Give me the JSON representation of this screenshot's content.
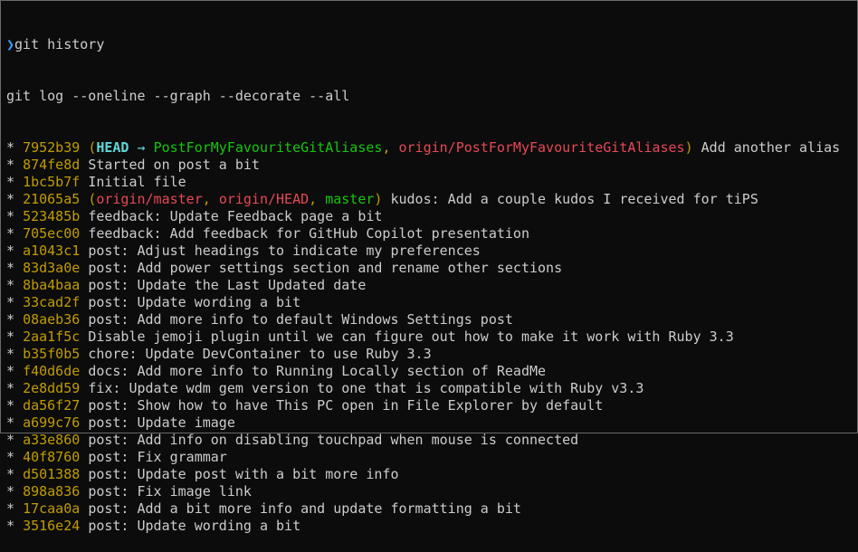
{
  "prompt": {
    "caret": "❯",
    "command": "git history"
  },
  "expanded_command": "git log --oneline --graph --decorate --all",
  "commits": [
    {
      "graph": "* ",
      "hash": "7952b39",
      "refs": {
        "head": "HEAD",
        "arrow": " → ",
        "current": "PostForMyFavouriteGitAliases",
        "others": [
          {
            "name": "origin/PostForMyFavouriteGitAliases",
            "type": "remote"
          }
        ]
      },
      "message": "Add another alias"
    },
    {
      "graph": "* ",
      "hash": "874fe8d",
      "message": "Started on post a bit"
    },
    {
      "graph": "* ",
      "hash": "1bc5b7f",
      "message": "Initial file"
    },
    {
      "graph": "* ",
      "hash": "21065a5",
      "refs": {
        "others": [
          {
            "name": "origin/master",
            "type": "remote"
          },
          {
            "name": "origin/HEAD",
            "type": "remote"
          },
          {
            "name": "master",
            "type": "local"
          }
        ]
      },
      "message": "kudos: Add a couple kudos I received for tiPS"
    },
    {
      "graph": "* ",
      "hash": "523485b",
      "message": "feedback: Update Feedback page a bit"
    },
    {
      "graph": "* ",
      "hash": "705ec00",
      "message": "feedback: Add feedback for GitHub Copilot presentation"
    },
    {
      "graph": "* ",
      "hash": "a1043c1",
      "message": "post: Adjust headings to indicate my preferences"
    },
    {
      "graph": "* ",
      "hash": "83d3a0e",
      "message": "post: Add power settings section and rename other sections"
    },
    {
      "graph": "* ",
      "hash": "8ba4baa",
      "message": "post: Update the Last Updated date"
    },
    {
      "graph": "* ",
      "hash": "33cad2f",
      "message": "post: Update wording a bit"
    },
    {
      "graph": "* ",
      "hash": "08aeb36",
      "message": "post: Add more info to default Windows Settings post"
    },
    {
      "graph": "* ",
      "hash": "2aa1f5c",
      "message": "Disable jemoji plugin until we can figure out how to make it work with Ruby 3.3"
    },
    {
      "graph": "* ",
      "hash": "b35f0b5",
      "message": "chore: Update DevContainer to use Ruby 3.3"
    },
    {
      "graph": "* ",
      "hash": "f40d6de",
      "message": "docs: Add more info to Running Locally section of ReadMe"
    },
    {
      "graph": "* ",
      "hash": "2e8dd59",
      "message": "fix: Update wdm gem version to one that is compatible with Ruby v3.3"
    },
    {
      "graph": "* ",
      "hash": "da56f27",
      "message": "post: Show how to have This PC open in File Explorer by default"
    },
    {
      "graph": "* ",
      "hash": "a699c76",
      "message": "post: Update image"
    },
    {
      "graph": "* ",
      "hash": "a33e860",
      "message": "post: Add info on disabling touchpad when mouse is connected"
    },
    {
      "graph": "* ",
      "hash": "40f8760",
      "message": "post: Fix grammar"
    },
    {
      "graph": "* ",
      "hash": "d501388",
      "message": "post: Update post with a bit more info"
    },
    {
      "graph": "* ",
      "hash": "898a836",
      "message": "post: Fix image link"
    },
    {
      "graph": "* ",
      "hash": "17caa0a",
      "message": "post: Add a bit more info and update formatting a bit"
    },
    {
      "graph": "* ",
      "hash": "3516e24",
      "message": "post: Update wording a bit"
    }
  ]
}
